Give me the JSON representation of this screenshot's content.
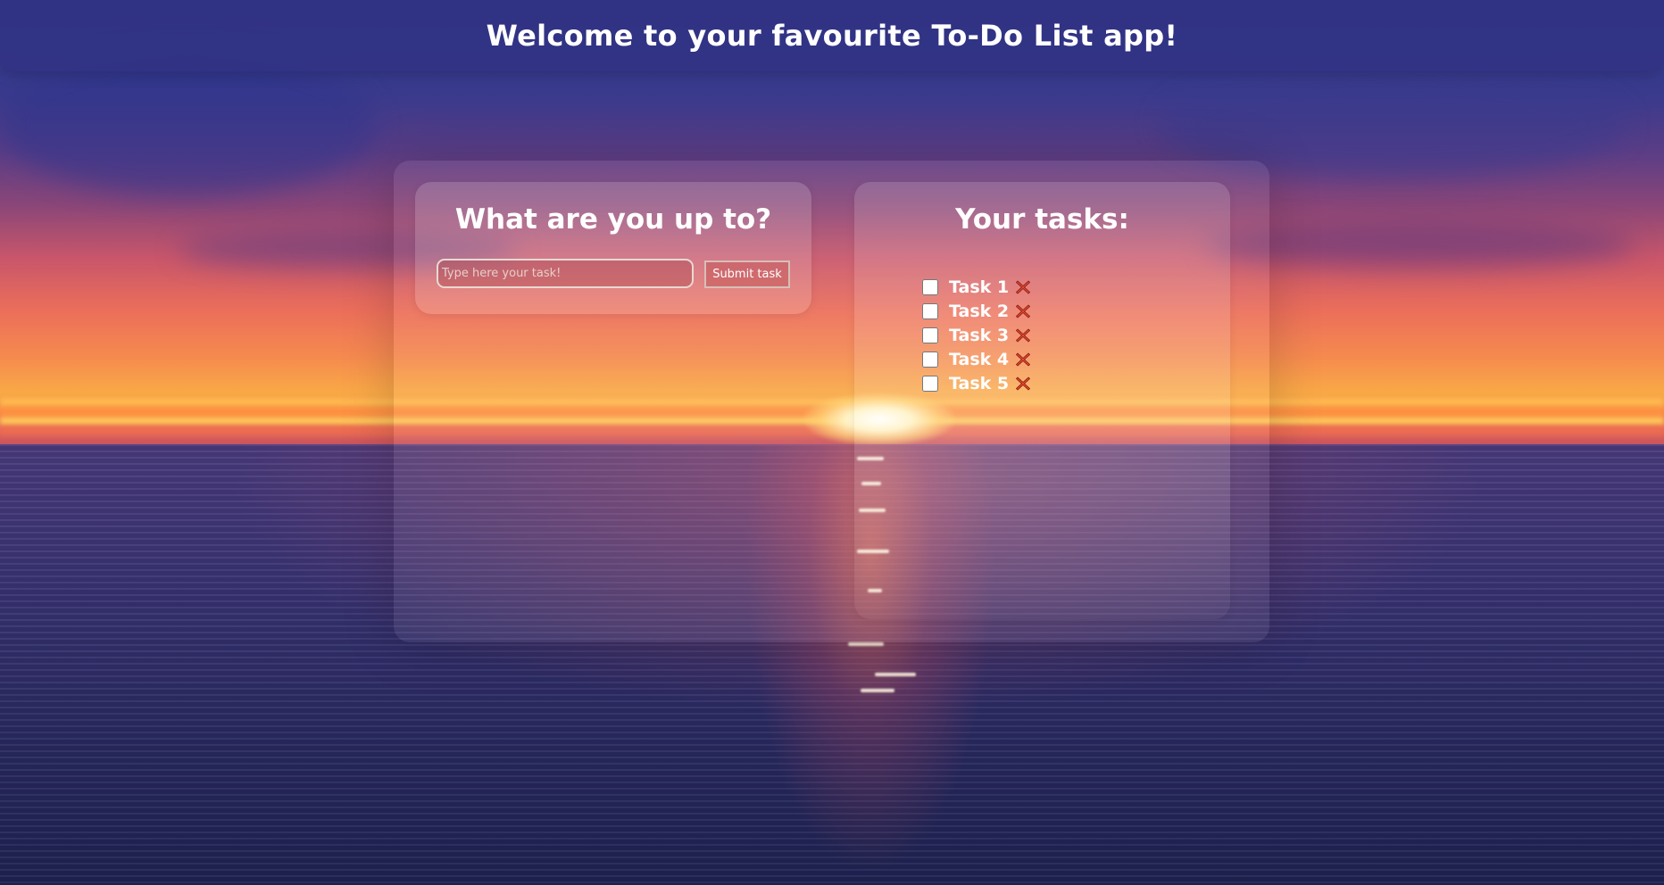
{
  "header": {
    "title": "Welcome to your favourite To-Do List app!"
  },
  "input_panel": {
    "title": "What are you up to?",
    "task_input": {
      "placeholder": "Type here your task!",
      "value": ""
    },
    "submit_label": "Submit task"
  },
  "tasks_panel": {
    "title": "Your tasks:",
    "tasks": [
      {
        "label": "Task 1",
        "checked": false,
        "delete_icon": "red-cross-icon"
      },
      {
        "label": "Task 2",
        "checked": false,
        "delete_icon": "red-cross-icon"
      },
      {
        "label": "Task 3",
        "checked": false,
        "delete_icon": "red-cross-icon"
      },
      {
        "label": "Task 4",
        "checked": false,
        "delete_icon": "red-cross-icon"
      },
      {
        "label": "Task 5",
        "checked": false,
        "delete_icon": "red-cross-icon"
      }
    ]
  },
  "colors": {
    "header_bg": "#32328a",
    "text": "#ffffff",
    "delete_icon": "#e8452c"
  }
}
